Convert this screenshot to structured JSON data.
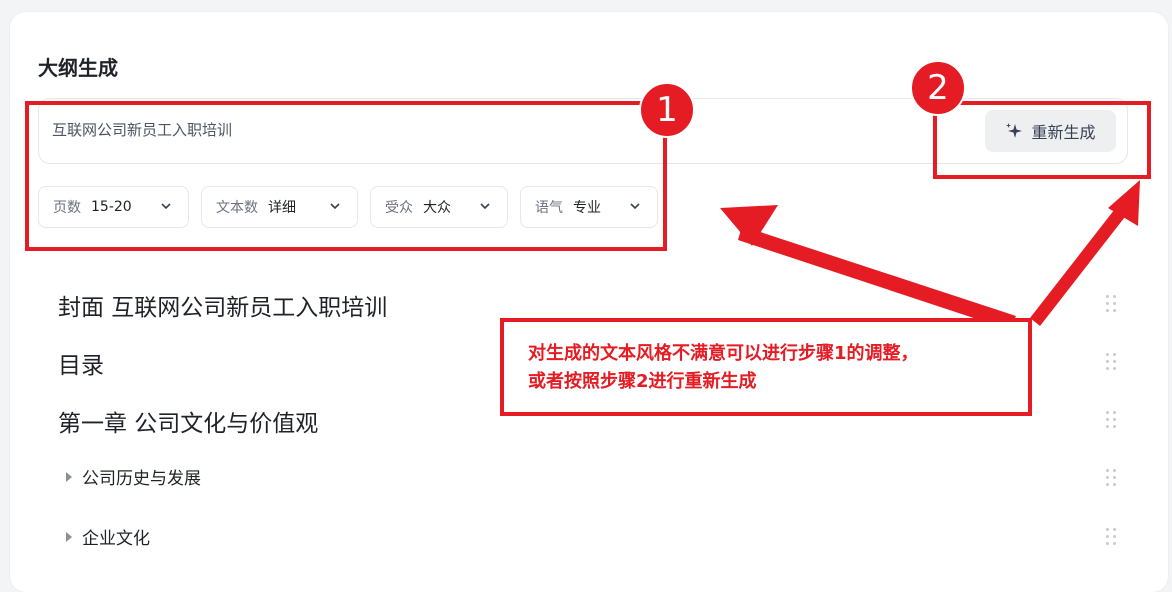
{
  "panel": {
    "title": "大纲生成",
    "prompt_value": "互联网公司新员工入职培训",
    "regenerate_label": "重新生成"
  },
  "filters": [
    {
      "label": "页数",
      "value": "15-20"
    },
    {
      "label": "文本数",
      "value": "详细"
    },
    {
      "label": "受众",
      "value": "大众"
    },
    {
      "label": "语气",
      "value": "专业"
    }
  ],
  "outline": [
    {
      "level": 1,
      "text": "封面 互联网公司新员工入职培训"
    },
    {
      "level": 1,
      "text": "目录"
    },
    {
      "level": 1,
      "text": "第一章 公司文化与价值观"
    },
    {
      "level": 2,
      "text": "公司历史与发展"
    },
    {
      "level": 2,
      "text": "企业文化"
    }
  ],
  "annotations": {
    "badge1": "1",
    "badge2": "2",
    "note_line1": "对生成的文本风格不满意可以进行步骤1的调整，",
    "note_line2": "或者按照步骤2进行重新生成",
    "color": "#e51c23"
  }
}
